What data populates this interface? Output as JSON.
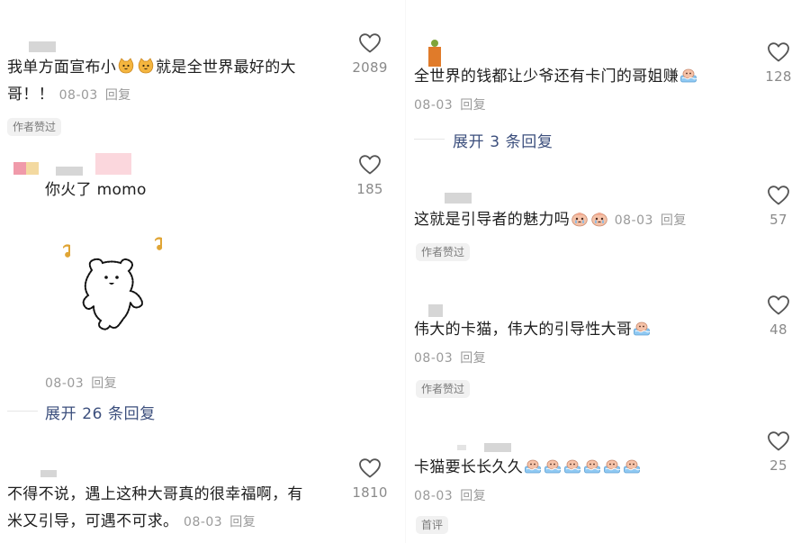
{
  "left": {
    "c1": {
      "line1": "我单方面宣布小",
      "mid": "就是全世界最好的大",
      "line2": "哥！！",
      "date": "08-03",
      "reply": "回复",
      "badge": "作者赞过",
      "likes": "2089"
    },
    "c2": {
      "text": "你火了 momo",
      "date": "08-03",
      "reply": "回复",
      "likes": "185",
      "expand": "展开 26 条回复"
    },
    "c3": {
      "line1": "不得不说，遇上这种大哥真的很幸福啊，有",
      "line2": "米又引导，可遇不可求。",
      "date": "08-03",
      "reply": "回复",
      "likes": "1810"
    }
  },
  "right": {
    "c1": {
      "text": "全世界的钱都让少爷还有卡门的哥姐赚",
      "date": "08-03",
      "reply": "回复",
      "likes": "128",
      "expand": "展开 3 条回复"
    },
    "c2": {
      "text": "这就是引导者的魅力吗",
      "date": "08-03",
      "reply": "回复",
      "badge": "作者赞过",
      "likes": "57"
    },
    "c3": {
      "text": "伟大的卡猫，伟大的引导性大哥",
      "date": "08-03",
      "reply": "回复",
      "badge": "作者赞过",
      "likes": "48"
    },
    "c4": {
      "text": "卡猫要长长久久",
      "date": "08-03",
      "reply": "回复",
      "badge": "首评",
      "likes": "25"
    }
  },
  "colors": {
    "expand_text": "#3c4f7d",
    "meta_text": "#9a9a9a",
    "badge_bg": "#f1f1f1",
    "heart_stroke": "#555555"
  }
}
